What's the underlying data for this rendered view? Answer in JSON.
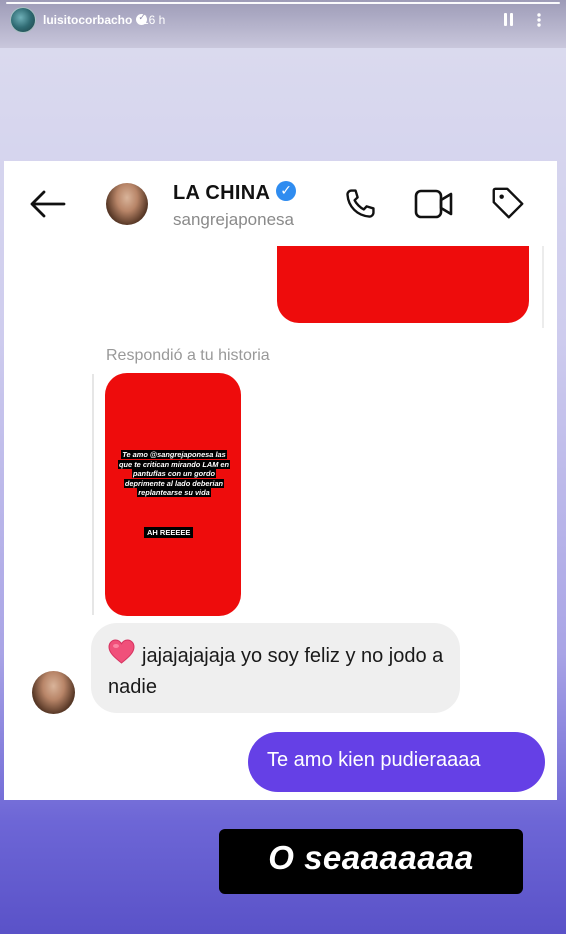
{
  "story": {
    "username": "luisitocorbacho",
    "time_ago": "16 h",
    "caption": "O seaaaaaaa"
  },
  "chat": {
    "contact_name": "LA CHINA",
    "contact_handle": "sangrejaponesa",
    "reply_label": "Respondió a tu historia",
    "story_text": "Te amo @sangrejaponesa las que te critican mirando LAM en pantuflas con un gordo deprimente al lado deberian replantearse su vida",
    "story_text_2": "AH REEEEE",
    "incoming_message": "jajajajajaja yo soy feliz y no jodo a nadie",
    "outgoing_message": "Te amo kien pudieraaaa"
  },
  "colors": {
    "accent_outgoing": "#6540e6",
    "red_redaction": "#ee0c0c",
    "verified_blue": "#2f8cf0"
  },
  "icons": [
    "back-arrow-icon",
    "phone-icon",
    "video-icon",
    "tag-icon",
    "heart-emoji-icon",
    "pause-icon",
    "more-icon",
    "verified-icon"
  ]
}
